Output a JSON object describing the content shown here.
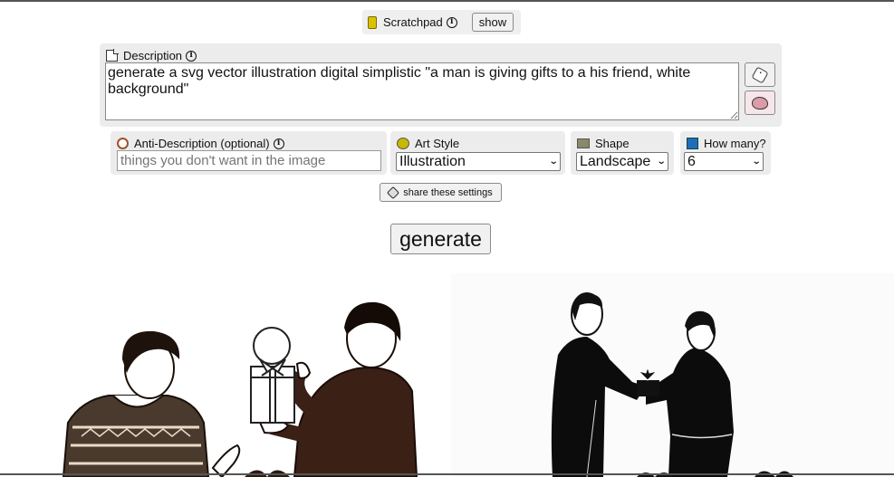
{
  "scratchpad": {
    "label": "Scratchpad",
    "info_icon": "info-icon",
    "show_label": "show"
  },
  "description": {
    "label": "Description",
    "icon": "note-icon",
    "value": "generate a svg vector illustration digital simplistic \"a man is giving gifts to a his friend, white background\"",
    "random_button_icon": "dice-icon",
    "brain_button_icon": "brain-icon"
  },
  "anti_description": {
    "label": "Anti-Description (optional)",
    "icon": "no-entry-icon",
    "value": "",
    "placeholder": "things you don't want in the image"
  },
  "art_style": {
    "label": "Art Style",
    "icon": "palette-icon",
    "selected": "Illustration"
  },
  "shape": {
    "label": "Shape",
    "icon": "image-icon",
    "selected": "Landscape"
  },
  "how_many": {
    "label": "How many?",
    "icon": "count-icon",
    "selected": "6"
  },
  "share_button": {
    "label": "share these settings",
    "icon": "tag-icon"
  },
  "generate_button": {
    "label": "generate"
  },
  "results": [
    {
      "alt": "Illustration of a man in a patterned sweater receiving a wrapped gift from a man in a dark sweater"
    },
    {
      "alt": "Illustration of a man in a black suit handing a gift box to a younger man"
    }
  ]
}
